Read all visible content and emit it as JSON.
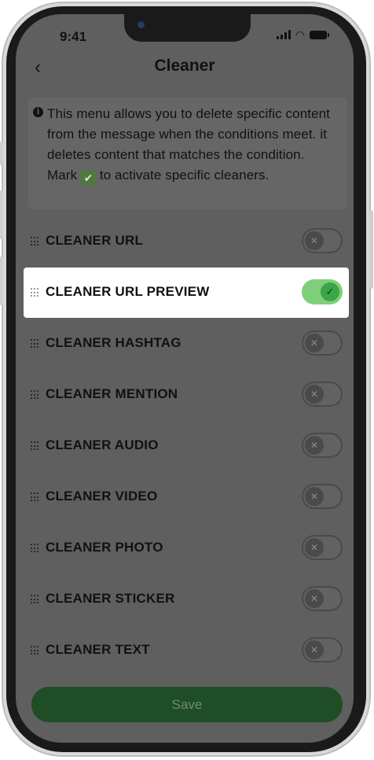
{
  "status_bar": {
    "time": "9:41"
  },
  "header": {
    "back_icon": "chevron-left-icon",
    "title": "Cleaner"
  },
  "info": {
    "text": "This menu allows you to delete specific content from the message when the conditions meet. it deletes content that matches the condition.",
    "mark_prefix": "Mark",
    "mark_suffix": "to activate specific cleaners."
  },
  "cleaners": [
    {
      "label": "CLEANER URL",
      "enabled": false
    },
    {
      "label": "CLEANER URL PREVIEW",
      "enabled": true
    },
    {
      "label": "CLEANER HASHTAG",
      "enabled": false
    },
    {
      "label": "CLEANER MENTION",
      "enabled": false
    },
    {
      "label": "CLEANER AUDIO",
      "enabled": false
    },
    {
      "label": "CLEANER VIDEO",
      "enabled": false
    },
    {
      "label": "CLEANER PHOTO",
      "enabled": false
    },
    {
      "label": "CLEANER STICKER",
      "enabled": false
    },
    {
      "label": "CLEANER TEXT",
      "enabled": false
    }
  ],
  "footer": {
    "save_label": "Save"
  },
  "colors": {
    "accent": "#3aa64a",
    "toggle_on": "#7fcf7a",
    "save_button": "#1f4d25",
    "overlay": "#5f5f5f"
  }
}
